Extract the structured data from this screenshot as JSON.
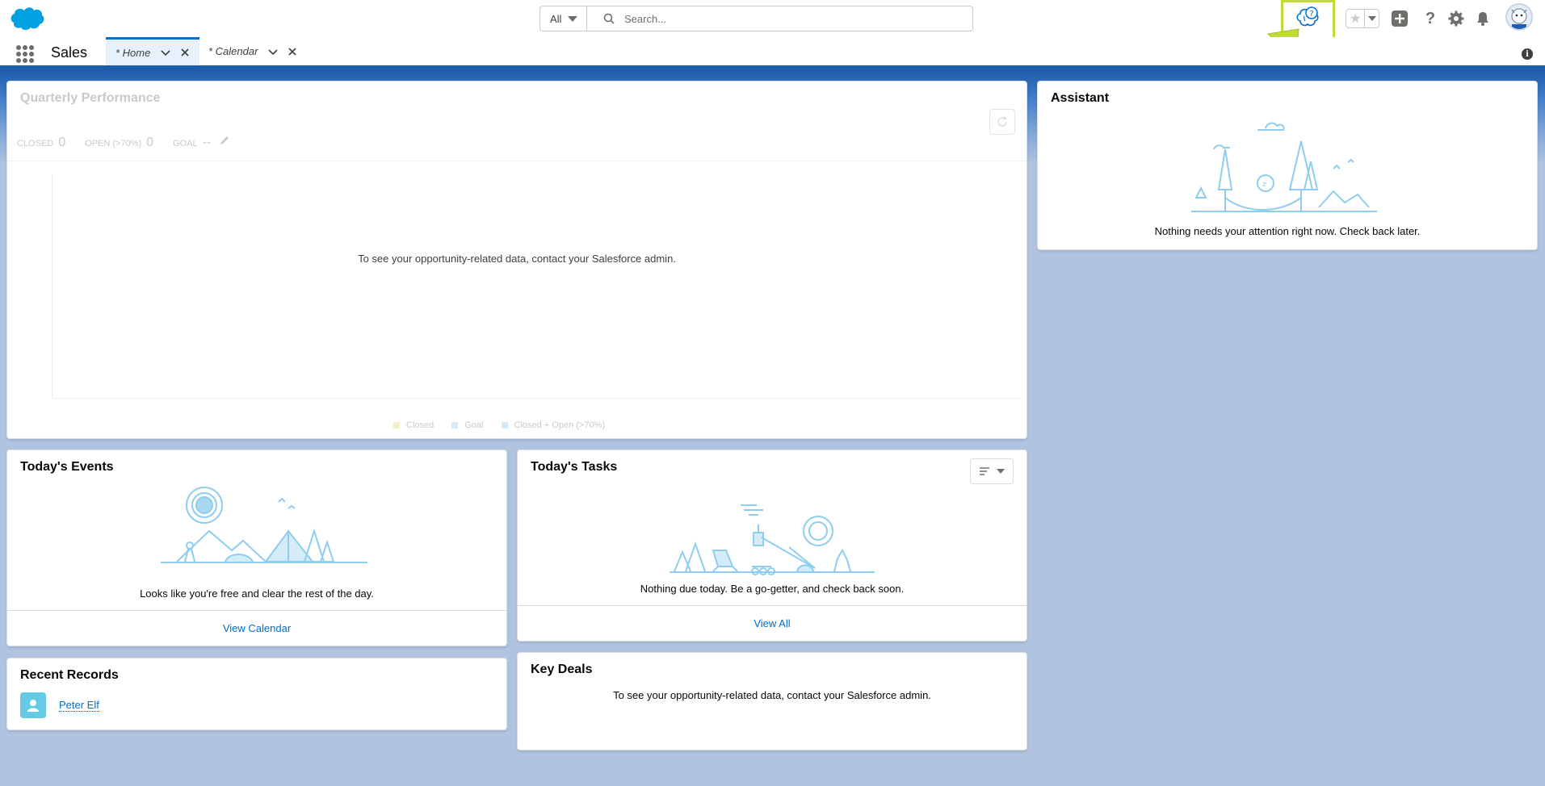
{
  "global_header": {
    "search": {
      "scope": "All",
      "placeholder": "Search..."
    },
    "icons": [
      "salesforce-logo",
      "einstein-help-icon",
      "favorites-star-icon",
      "global-actions-icon",
      "help-icon",
      "setup-gear-icon",
      "notifications-bell-icon",
      "user-avatar"
    ]
  },
  "nav": {
    "app_name": "Sales",
    "tabs": [
      {
        "label": "* Home",
        "active": true
      },
      {
        "label": "* Calendar",
        "active": false
      }
    ]
  },
  "quarterly_performance": {
    "title": "Quarterly Performance",
    "stats": [
      {
        "label": "CLOSED",
        "value": "0"
      },
      {
        "label": "OPEN (>70%)",
        "value": "0"
      },
      {
        "label": "GOAL",
        "value": "--"
      }
    ],
    "message": "To see your opportunity-related data, contact your Salesforce admin.",
    "legend": [
      {
        "label": "Closed",
        "color": "#f3f0c8"
      },
      {
        "label": "Goal",
        "color": "#d8e8f6"
      },
      {
        "label": "Closed + Open (>70%)",
        "color": "#d3ecf7"
      }
    ]
  },
  "assistant": {
    "title": "Assistant",
    "message": "Nothing needs your attention right now. Check back later."
  },
  "todays_events": {
    "title": "Today's Events",
    "message": "Looks like you're free and clear the rest of the day.",
    "footer_link": "View Calendar"
  },
  "todays_tasks": {
    "title": "Today's Tasks",
    "message": "Nothing due today. Be a go-getter, and check back soon.",
    "footer_link": "View All"
  },
  "recent_records": {
    "title": "Recent Records",
    "items": [
      {
        "name": "Peter Elf"
      }
    ]
  },
  "key_deals": {
    "title": "Key Deals",
    "message": "To see your opportunity-related data, contact your Salesforce admin."
  },
  "colors": {
    "brand_blue": "#1b5fb2",
    "link": "#006dcc",
    "highlight": "#c2d93a",
    "illustration": "#8fcdef"
  }
}
